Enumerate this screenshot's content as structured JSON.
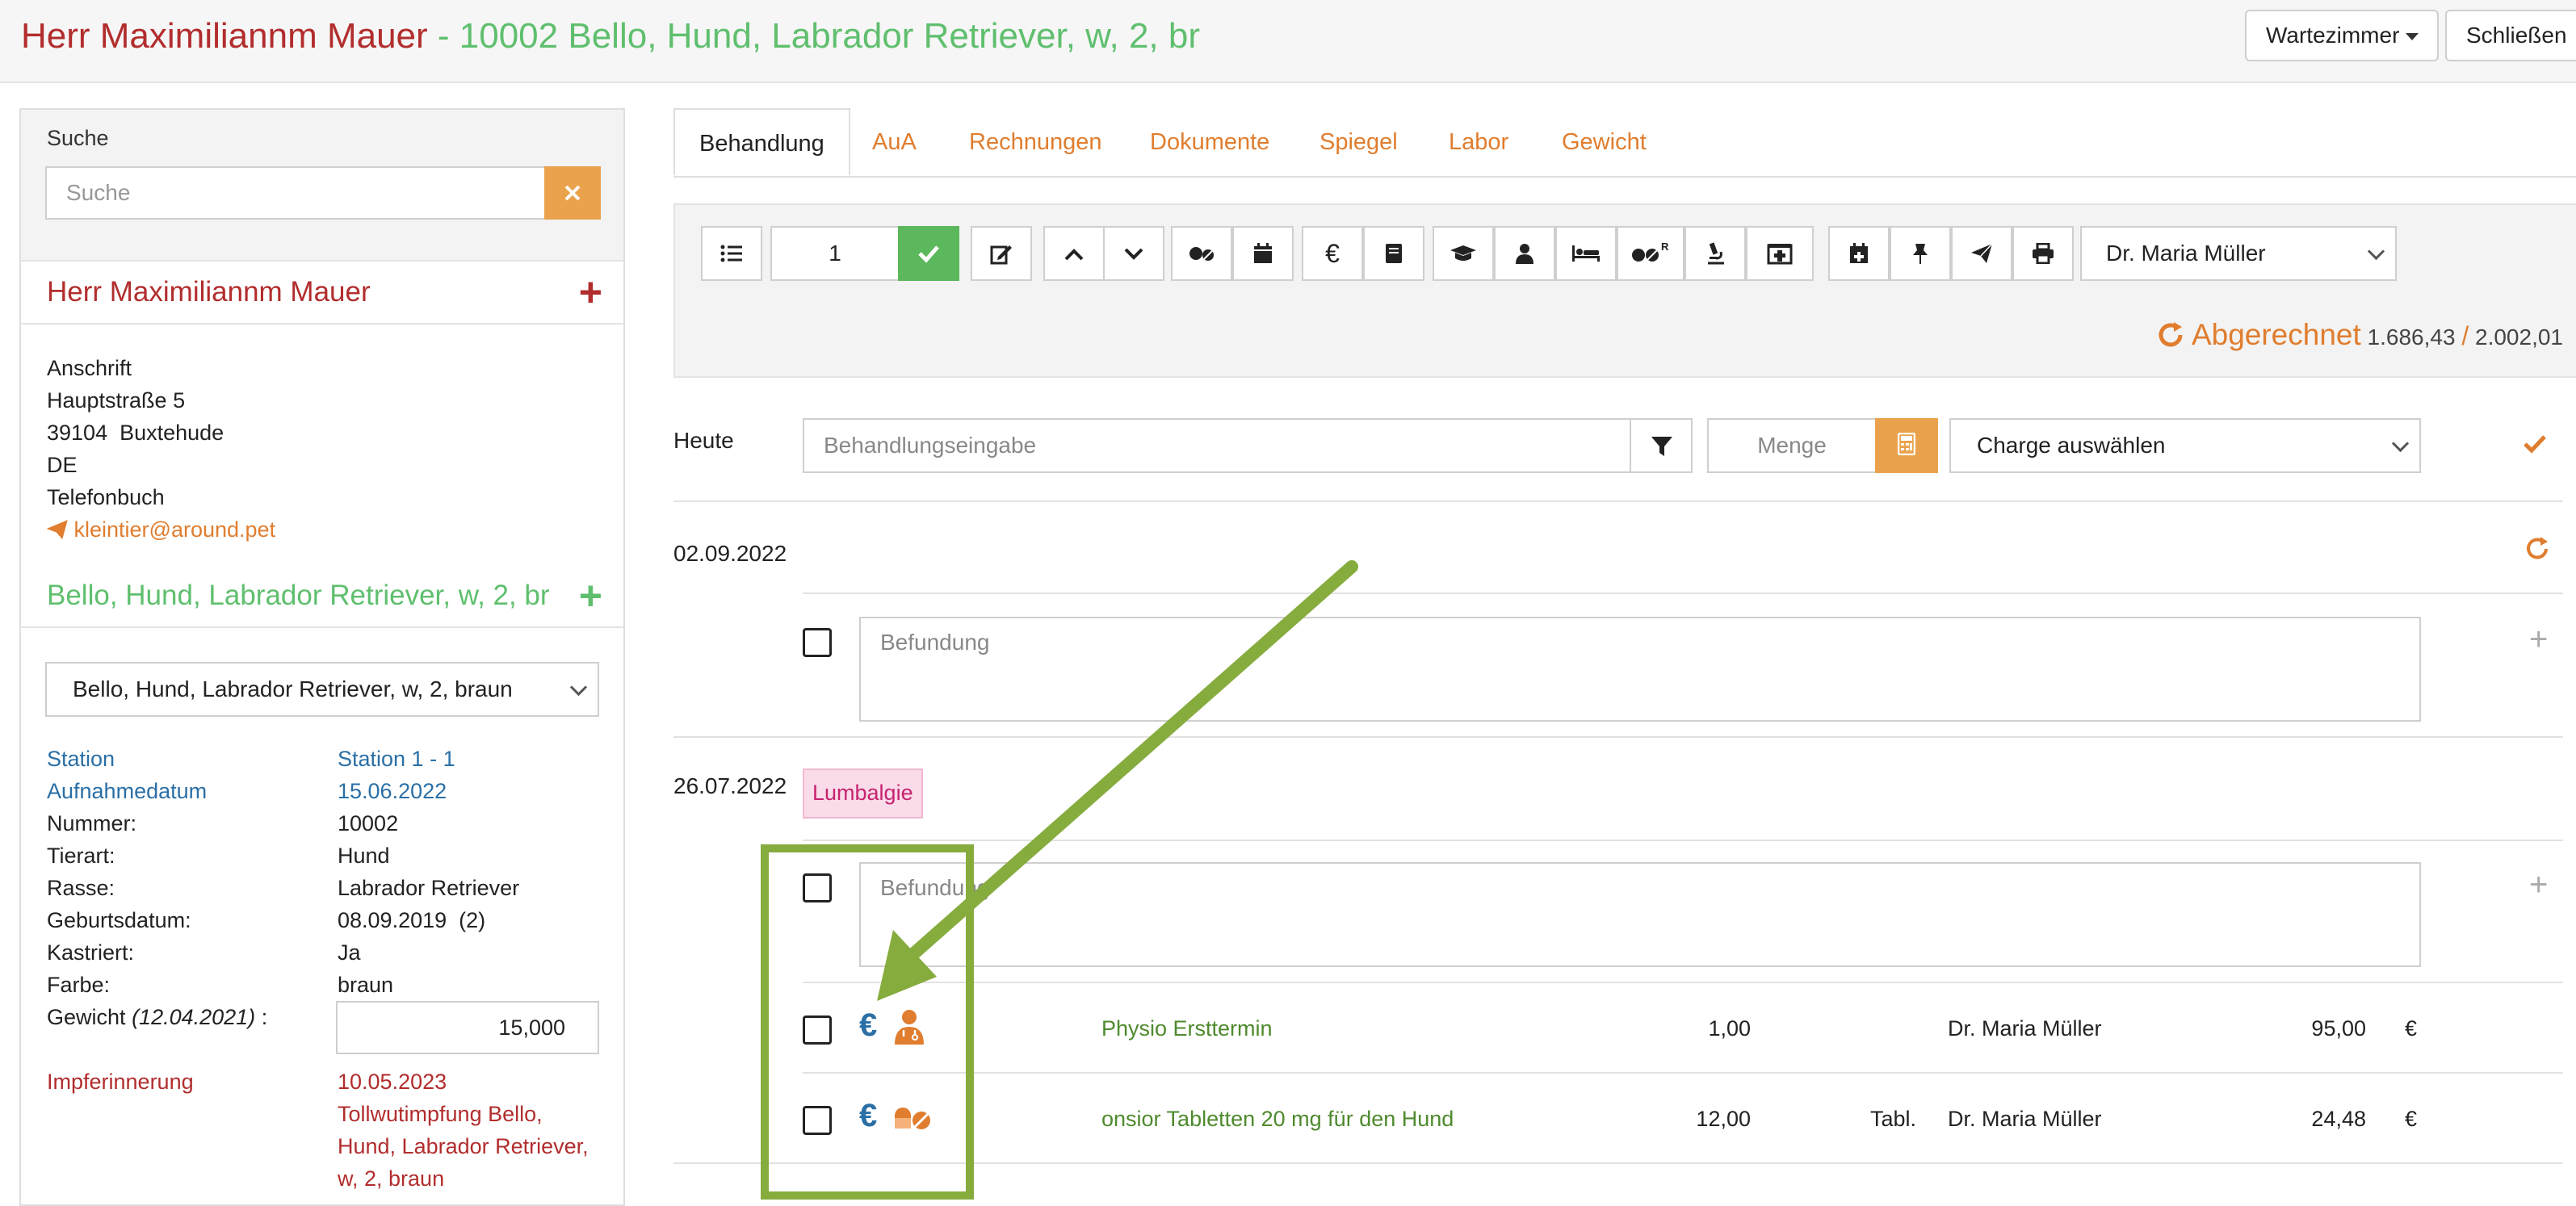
{
  "header": {
    "owner": "Herr Maximiliannm Mauer",
    "patient": " - 10002 Bello, Hund, Labrador Retriever, w, 2, br",
    "wartezimmer": "Wartezimmer",
    "close": "Schließen"
  },
  "sidebar": {
    "search_label": "Suche",
    "search_placeholder": "Suche",
    "owner_name": "Herr Maximiliannm Mauer",
    "address_heading": "Anschrift",
    "street": "Hauptstraße 5",
    "city": "39104  Buxtehude",
    "country": "DE",
    "phonebook": "Telefonbuch",
    "email": "kleintier@around.pet",
    "patient_short": "Bello, Hund, Labrador Retriever, w, 2, br",
    "patient_select": "Bello, Hund, Labrador Retriever, w, 2, braun",
    "info": [
      {
        "key": "Station",
        "value": "Station 1 - 1"
      },
      {
        "key": "Aufnahmedatum",
        "value": "15.06.2022"
      },
      {
        "key": "Nummer:",
        "value": "10002"
      },
      {
        "key": "Tierart:",
        "value": "Hund"
      },
      {
        "key": "Rasse:",
        "value": "Labrador Retriever"
      },
      {
        "key": "Geburtsdatum:",
        "value": "08.09.2019  (2)"
      },
      {
        "key": "Kastriert:",
        "value": "Ja"
      },
      {
        "key": "Farbe:",
        "value": "braun"
      }
    ],
    "weight_label": "Gewicht",
    "weight_date": "(12.04.2021)",
    "weight_colon": " :",
    "weight_value": "15,000",
    "vaccine_label": "Impferinnerung",
    "vaccine_date": "10.05.2023",
    "vaccine_text": [
      "Tollwutimpfung Bello,",
      "Hund, Labrador Retriever,",
      "w, 2, braun"
    ]
  },
  "tabs": [
    "Behandlung",
    "AuA",
    "Rechnungen",
    "Dokumente",
    "Spiegel",
    "Labor",
    "Gewicht"
  ],
  "toolbar": {
    "count": "1",
    "doctor": "Dr. Maria Müller",
    "billing_label": "Abgerechnet",
    "billed": "1.686,43",
    "separator": "/",
    "total": "2.002,01"
  },
  "entry": {
    "today": "Heute",
    "placeholder": "Behandlungseingabe",
    "menge": "Menge",
    "charge": "Charge auswählen"
  },
  "entries": [
    {
      "date": "02.09.2022",
      "befund": "Befundung"
    },
    {
      "date": "26.07.2022",
      "diagnosis": "Lumbalgie",
      "befund": "Befundung"
    }
  ],
  "items": [
    {
      "name": "Physio Ersttermin",
      "qty": "1,00",
      "unit": "",
      "doctor": "Dr. Maria Müller",
      "price": "95,00",
      "currency": "€"
    },
    {
      "name": "onsior Tabletten 20 mg für den Hund",
      "qty": "12,00",
      "unit": "Tabl.",
      "doctor": "Dr. Maria Müller",
      "price": "24,48",
      "currency": "€"
    }
  ],
  "colors": {
    "owner": "#b22d2d",
    "patient": "#5fbf6e",
    "accent": "#e07d2e",
    "highlight": "#86ac3e"
  }
}
